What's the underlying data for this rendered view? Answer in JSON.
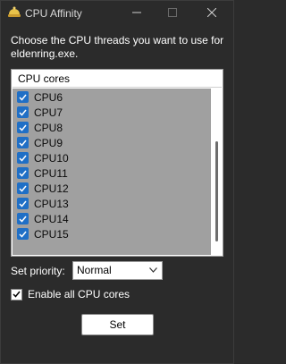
{
  "window": {
    "title": "CPU Affinity",
    "controls": {
      "minimize": "–",
      "maximize": "☐",
      "close": "✕"
    }
  },
  "description": "Choose the CPU threads you want to use for eldenring.exe.",
  "cpu_list": {
    "header": "CPU cores",
    "items": [
      {
        "label": "CPU6",
        "checked": true
      },
      {
        "label": "CPU7",
        "checked": true
      },
      {
        "label": "CPU8",
        "checked": true
      },
      {
        "label": "CPU9",
        "checked": true
      },
      {
        "label": "CPU10",
        "checked": true
      },
      {
        "label": "CPU11",
        "checked": true
      },
      {
        "label": "CPU12",
        "checked": true
      },
      {
        "label": "CPU13",
        "checked": true
      },
      {
        "label": "CPU14",
        "checked": true
      },
      {
        "label": "CPU15",
        "checked": true
      }
    ]
  },
  "priority": {
    "label": "Set priority:",
    "selected": "Normal"
  },
  "enable_all": {
    "label": "Enable all CPU cores",
    "checked": true
  },
  "set_button": {
    "label": "Set"
  },
  "colors": {
    "accent": "#1f6fc6",
    "window_bg": "#2b2b2b",
    "list_bg": "#a0a0a0"
  }
}
